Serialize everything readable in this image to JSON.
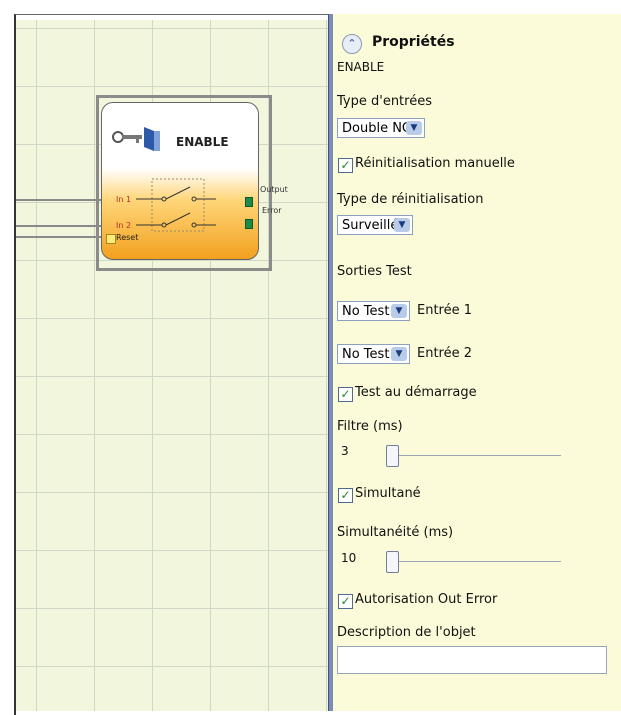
{
  "block": {
    "title": "ENABLE",
    "pin_in1": "In 1",
    "pin_in2": "In 2",
    "pin_reset": "Reset",
    "pin_output": "Output",
    "pin_error": "Error"
  },
  "panel": {
    "header": "Propriétés",
    "object_name": "ENABLE",
    "input_type_label": "Type d'entrées",
    "input_type_value": "Double NO",
    "manual_reset_label": "Réinitialisation manuelle",
    "manual_reset_checked": true,
    "reset_type_label": "Type de réinitialisation",
    "reset_type_value": "Surveillé",
    "test_outputs_label": "Sorties Test",
    "test1_value": "No Test",
    "test1_label": "Entrée 1",
    "test2_value": "No Test",
    "test2_label": "Entrée 2",
    "startup_test_label": "Test au démarrage",
    "startup_test_checked": true,
    "filter_label": "Filtre (ms)",
    "filter_value": "3",
    "simultaneous_label": "Simultané",
    "simultaneous_checked": true,
    "simultaneity_label": "Simultanéité (ms)",
    "simultaneity_value": "10",
    "out_error_label": "Autorisation Out Error",
    "out_error_checked": true,
    "description_label": "Description de l'objet",
    "description_value": ""
  },
  "colors": {
    "panel_bg": "#fcfbd9",
    "canvas_bg": "#f2f6dc",
    "block_orange": "#f2a11e",
    "check_green": "#1f8a1f"
  }
}
